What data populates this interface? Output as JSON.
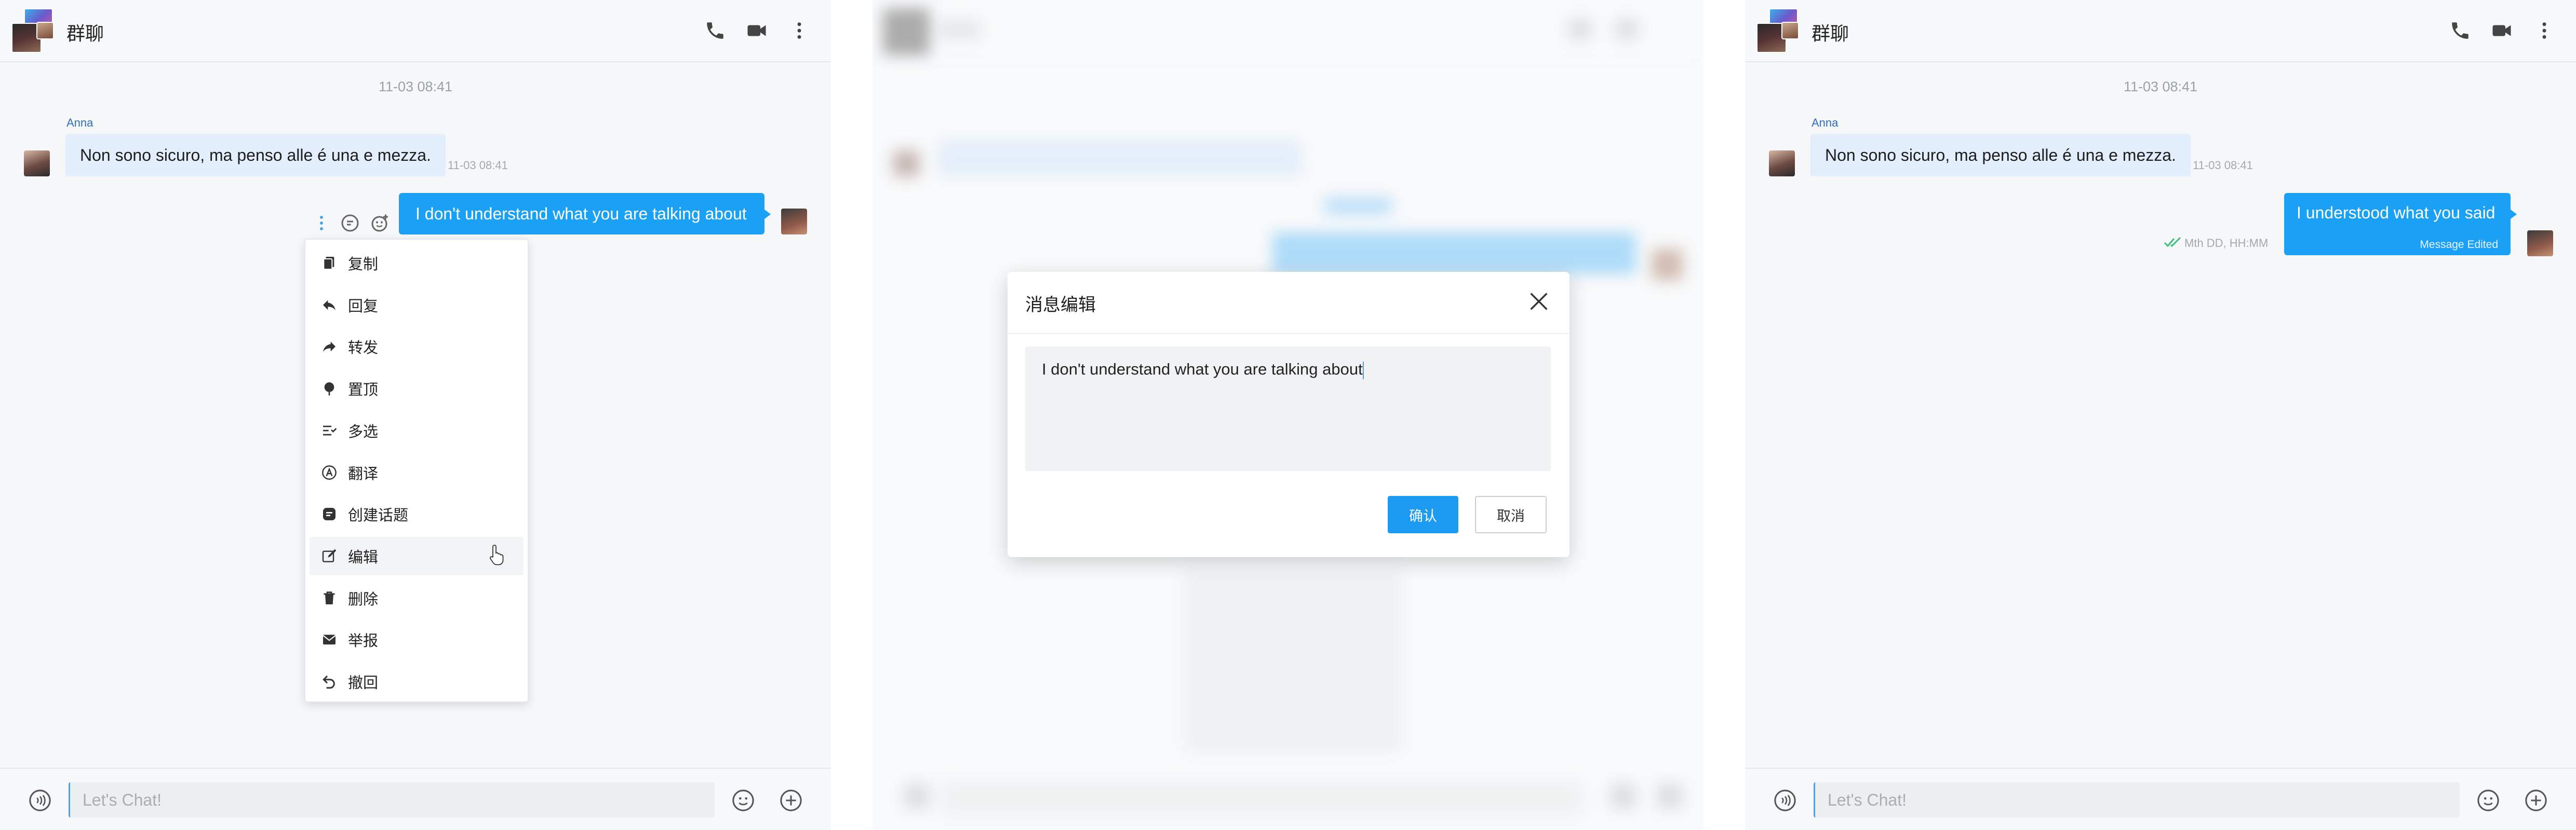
{
  "header": {
    "title": "群聊"
  },
  "chat": {
    "date_divider": "11-03 08:41",
    "sender_name": "Anna",
    "incoming_text": "Non sono sicuro, ma penso alle é una e mezza.",
    "incoming_time": "11-03 08:41",
    "outgoing_original": "I don't understand what you are talking about",
    "outgoing_edited": "I understood what you said",
    "edited_label": "Message Edited",
    "outgoing_status_time": "Mth DD, HH:MM"
  },
  "context_menu": {
    "items": [
      {
        "label": "复制",
        "icon": "copy-icon"
      },
      {
        "label": "回复",
        "icon": "reply-icon"
      },
      {
        "label": "转发",
        "icon": "forward-icon"
      },
      {
        "label": "置顶",
        "icon": "pin-icon"
      },
      {
        "label": "多选",
        "icon": "multiselect-icon"
      },
      {
        "label": "翻译",
        "icon": "translate-icon"
      },
      {
        "label": "创建话题",
        "icon": "thread-icon"
      },
      {
        "label": "编辑",
        "icon": "edit-icon"
      },
      {
        "label": "删除",
        "icon": "trash-icon"
      },
      {
        "label": "举报",
        "icon": "report-icon"
      },
      {
        "label": "撤回",
        "icon": "recall-icon"
      }
    ],
    "hovered_index": 7
  },
  "dialog": {
    "title": "消息编辑",
    "text": "I don't understand what you are talking about",
    "confirm_label": "确认",
    "cancel_label": "取消"
  },
  "footer": {
    "input_placeholder": "Let's Chat!"
  },
  "colors": {
    "accent": "#1aa1f5",
    "incoming_bubble": "#e2eefb",
    "read_check": "#3fbf7f"
  }
}
